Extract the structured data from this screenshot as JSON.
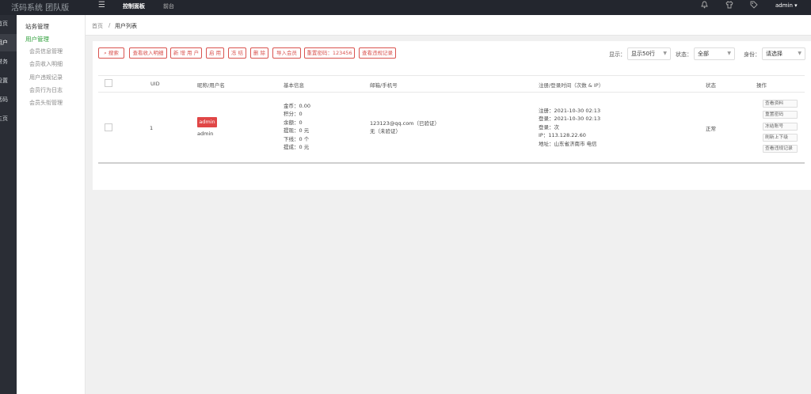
{
  "app": {
    "title": "活码系统 团队版"
  },
  "topnav": {
    "toggle_icon": "menu-icon",
    "items": [
      "控制面板",
      "前台"
    ],
    "user": "admin"
  },
  "leftbar": {
    "items": [
      "首页",
      "用户",
      "财务",
      "设置",
      "活码",
      "主页"
    ]
  },
  "sidebar": {
    "heading": "站务管理",
    "group": "用户管理",
    "items": [
      "会员信息管理",
      "会员收入明细",
      "用户违规记录",
      "会员行为日志",
      "会员头衔管理"
    ]
  },
  "breadcrumb": {
    "home": "首页",
    "sep": "/",
    "current": "用户列表"
  },
  "toolbar": {
    "buttons": [
      "搜索",
      "查看收入明细",
      "新 增 用 户",
      "启 用",
      "冻 结",
      "删 除",
      "导入会员",
      "重置密码：123456",
      "查看违规记录"
    ],
    "filters": [
      {
        "label": "显示：",
        "value": "显示50行"
      },
      {
        "label": "状态：",
        "value": "全部"
      },
      {
        "label": "身份：",
        "value": "请选择"
      }
    ]
  },
  "table": {
    "headers": [
      "UID",
      "昵称/用户名",
      "基本信息",
      "邮箱/手机号",
      "注册/登录时间（次数 & IP）",
      "状态",
      "操作"
    ],
    "rows": [
      {
        "uid": "1",
        "nickname_tag": "admin",
        "username": "admin",
        "info": [
          "金币：0.00",
          "积分：0",
          "余额：0",
          "提现：0 元",
          "下线：0 个",
          "提成：0 元"
        ],
        "contact": [
          "123123@qq.com（已验证）",
          "无（未验证）"
        ],
        "times": [
          "注册：2021-10-30 02:13",
          "登录：2021-10-30 02:13",
          "登录：次",
          "IP：113.128.22.60",
          "地址：山东省济南市 电信"
        ],
        "status": "正常",
        "actions": [
          "查看资料",
          "重置密码",
          "冻结账号",
          "刷新上下级",
          "查看违规记录"
        ]
      }
    ]
  },
  "colors": {
    "accent": "#d9534f",
    "topbar": "#23262e",
    "green": "#2e9f3a"
  }
}
